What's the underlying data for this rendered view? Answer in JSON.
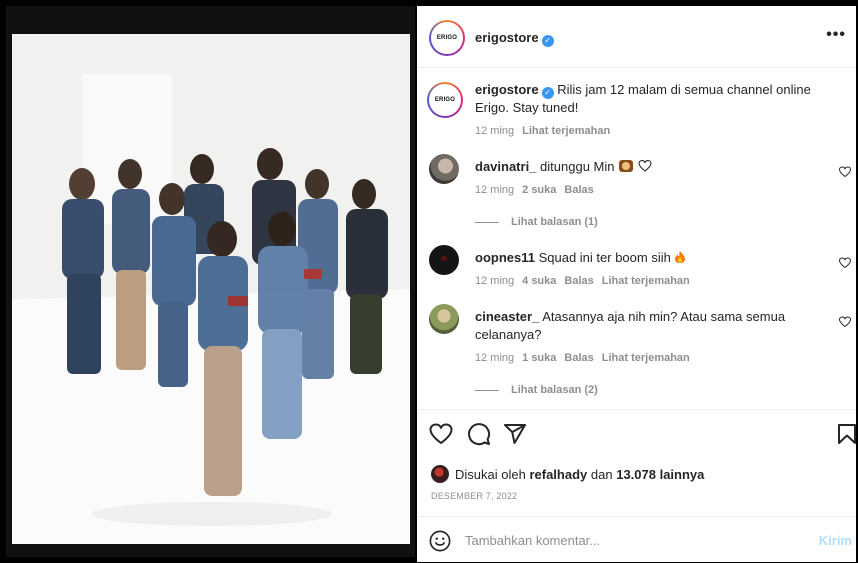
{
  "post": {
    "username": "erigostore",
    "avatar_label": "ERIGO",
    "more_label": "•••"
  },
  "caption": {
    "username": "erigostore",
    "text": "Rilis jam 12 malam di semua channel online Erigo. Stay tuned!",
    "time": "12 ming",
    "translate": "Lihat terjemahan"
  },
  "comments": [
    {
      "username": "davinatri_",
      "text": "ditunggu Min",
      "time": "12 ming",
      "likes": "2 suka",
      "reply": "Balas",
      "replies": "Lihat balasan (1)"
    },
    {
      "username": "oopnes11",
      "text": "Squad ini ter boom siih",
      "time": "12 ming",
      "likes": "4 suka",
      "reply": "Balas",
      "translate": "Lihat terjemahan"
    },
    {
      "username": "cineaster_",
      "text": "Atasannya aja nih min? Atau sama semua celananya?",
      "time": "12 ming",
      "likes": "1 suka",
      "reply": "Balas",
      "translate": "Lihat terjemahan",
      "replies": "Lihat balasan (2)"
    }
  ],
  "likes": {
    "prefix": "Disukai oleh",
    "user": "refalhady",
    "middle": "dan",
    "count": "13.078 lainnya"
  },
  "date": "DESEMBER 7, 2022",
  "add_comment": {
    "placeholder": "Tambahkan komentar...",
    "send_label": "Kirim"
  },
  "colors": {
    "verified": "#3897f0",
    "link_disabled": "#b2dffc",
    "muted": "#8e8e8e",
    "text": "#262626"
  }
}
